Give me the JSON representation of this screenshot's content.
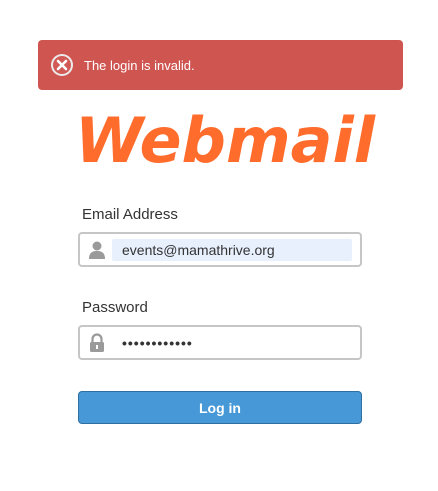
{
  "alert": {
    "message": "The login is invalid.",
    "icon": "error-x-icon",
    "color": "#cf5551"
  },
  "logo": {
    "text": "Webmail",
    "color": "#ff6c2c"
  },
  "email": {
    "label": "Email Address",
    "value": "events@mamathrive.org",
    "icon": "user-icon"
  },
  "password": {
    "label": "Password",
    "value": "••••••••••••",
    "icon": "lock-icon"
  },
  "login_button": {
    "label": "Log in",
    "color": "#4698d6"
  }
}
